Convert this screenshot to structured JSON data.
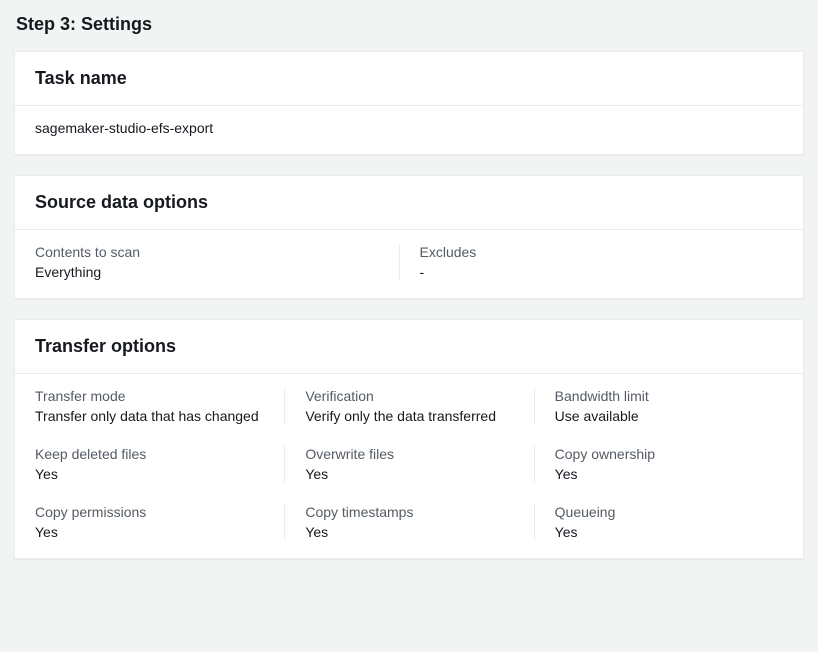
{
  "pageTitle": "Step 3: Settings",
  "taskName": {
    "header": "Task name",
    "value": "sagemaker-studio-efs-export"
  },
  "sourceDataOptions": {
    "header": "Source data options",
    "contentsToScan": {
      "label": "Contents to scan",
      "value": "Everything"
    },
    "excludes": {
      "label": "Excludes",
      "value": "-"
    }
  },
  "transferOptions": {
    "header": "Transfer options",
    "transferMode": {
      "label": "Transfer mode",
      "value": "Transfer only data that has changed"
    },
    "verification": {
      "label": "Verification",
      "value": "Verify only the data transferred"
    },
    "bandwidthLimit": {
      "label": "Bandwidth limit",
      "value": "Use available"
    },
    "keepDeletedFiles": {
      "label": "Keep deleted files",
      "value": "Yes"
    },
    "overwriteFiles": {
      "label": "Overwrite files",
      "value": "Yes"
    },
    "copyOwnership": {
      "label": "Copy ownership",
      "value": "Yes"
    },
    "copyPermissions": {
      "label": "Copy permissions",
      "value": "Yes"
    },
    "copyTimestamps": {
      "label": "Copy timestamps",
      "value": "Yes"
    },
    "queueing": {
      "label": "Queueing",
      "value": "Yes"
    }
  }
}
